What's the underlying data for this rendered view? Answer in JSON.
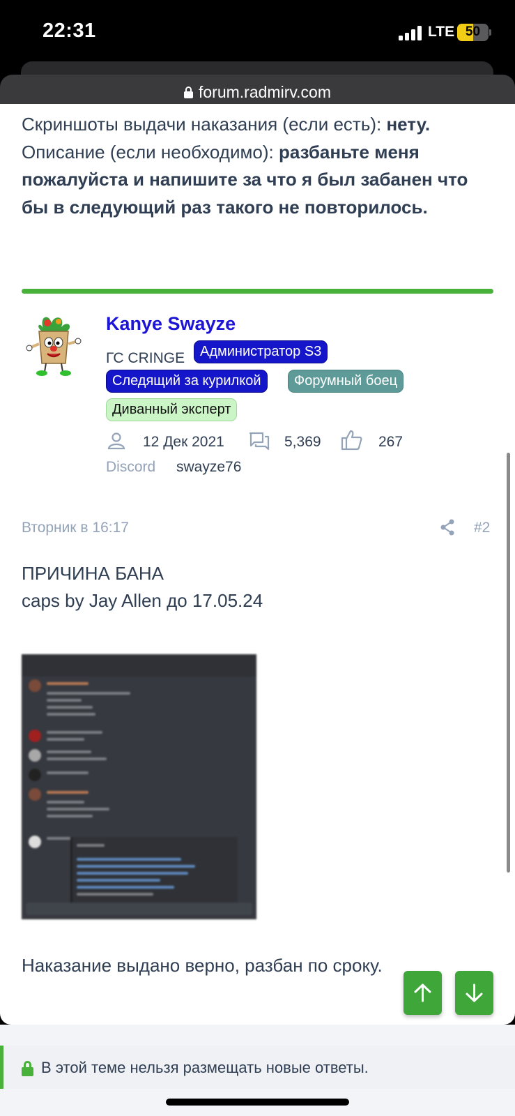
{
  "status_bar": {
    "time": "22:31",
    "network": "LTE",
    "battery": "50",
    "battery_level": 0.5
  },
  "browser": {
    "url": "forum.radmirv.com"
  },
  "prev_post": {
    "screenshots_label": "Скриншоты выдачи наказания (если есть): ",
    "screenshots_value": "нету.",
    "description_label": "Описание (если необходимо): ",
    "description_value": "разбаньте меня пожалуйста и напишите за что я был забанен что бы в следующий раз такого не повторилось."
  },
  "author": {
    "name": "Kanye Swayze",
    "title": "ГС CRINGE",
    "badges": [
      {
        "label": "Администратор S3"
      },
      {
        "label": "Следящий за курилкой"
      },
      {
        "label": "Форумный боец"
      },
      {
        "label": "Диванный эксперт"
      }
    ],
    "joined": "12 Дек 2021",
    "messages": "5,369",
    "reactions": "267",
    "discord_label": "Discord",
    "discord_value": "swayze76",
    "icons": [
      "user-icon",
      "messages-icon",
      "thumbs-up-icon"
    ]
  },
  "post": {
    "date": "Вторник в 16:17",
    "number": "#2",
    "reason_title": "ПРИЧИНА БАНА",
    "reason_text": "caps by Jay Allen до 17.05.24",
    "verdict": "Наказание выдано верно, разбан по сроку."
  },
  "footer": {
    "notice": "В этой теме нельзя размещать новые ответы."
  },
  "colors": {
    "accent_green": "#47b139",
    "link_blue": "#1d15d6",
    "badge_blue": "#1515c9",
    "badge_teal": "#5e9b98",
    "badge_light_green": "#ccf5c7",
    "text": "#2f3e52",
    "muted": "#94a3b8"
  }
}
